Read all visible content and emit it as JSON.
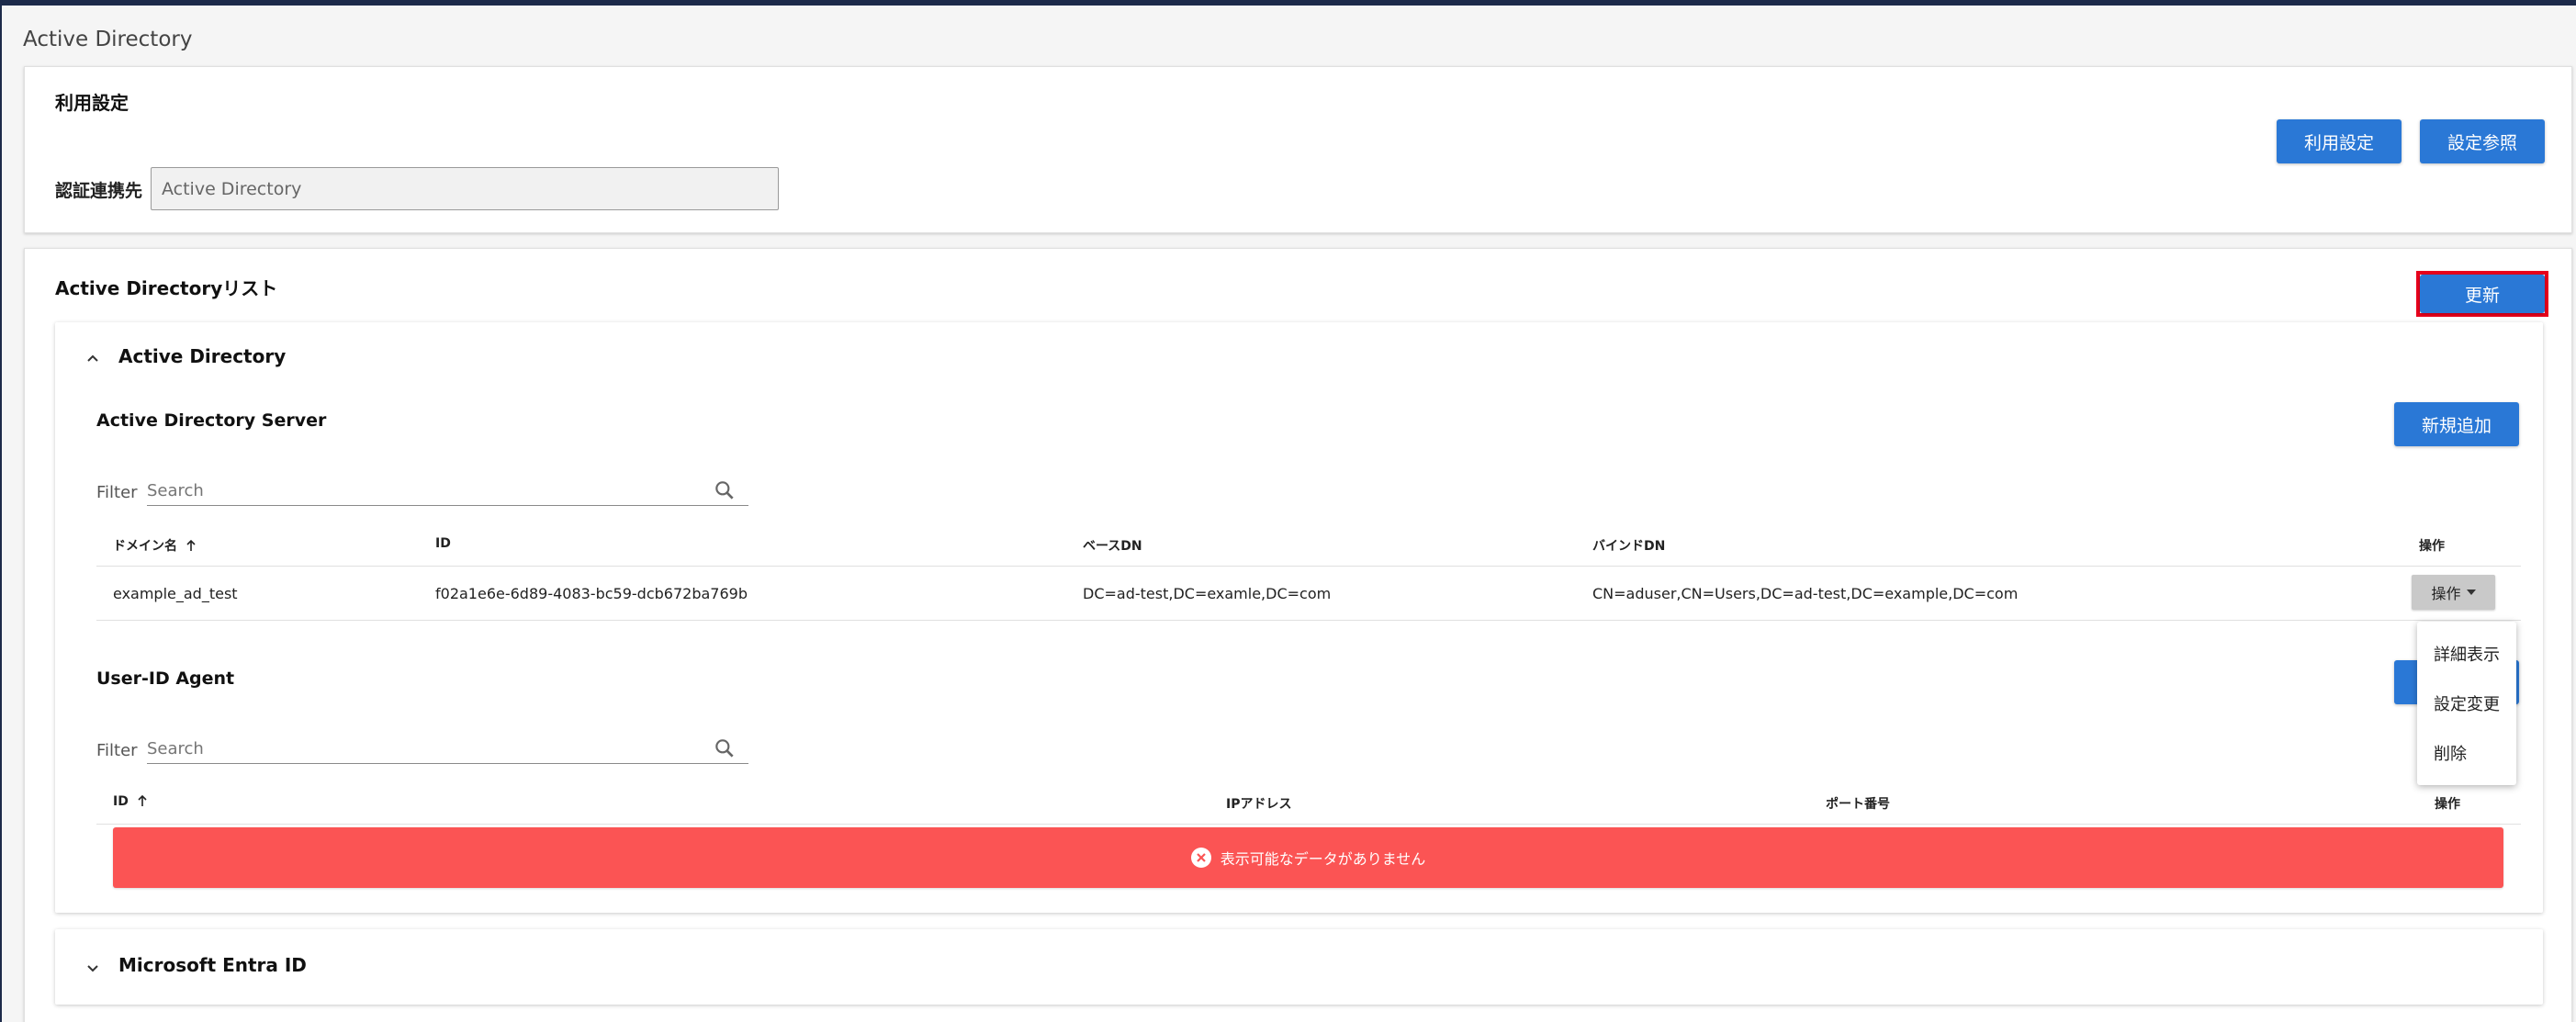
{
  "page": {
    "title": "Active Directory"
  },
  "settings": {
    "section_title": "利用設定",
    "auth_label": "認証連携先",
    "auth_value": "Active Directory",
    "buttons": {
      "use_settings": "利用設定",
      "view_settings": "設定参照"
    }
  },
  "ad_list": {
    "title": "Active Directoryリスト",
    "refresh_button": "更新",
    "accordion_title": "Active Directory",
    "server": {
      "title": "Active Directory Server",
      "add_button": "新規追加",
      "filter_label": "Filter",
      "search_placeholder": "Search",
      "columns": [
        "ドメイン名",
        "ID",
        "ベースDN",
        "バインドDN",
        "操作"
      ],
      "rows": [
        {
          "domain": "example_ad_test",
          "id": "f02a1e6e-6d89-4083-bc59-dcb672ba769b",
          "base_dn": "DC=ad-test,DC=examle,DC=com",
          "bind_dn": "CN=aduser,CN=Users,DC=ad-test,DC=example,DC=com",
          "ops_label": "操作"
        }
      ]
    },
    "ops_menu": [
      "詳細表示",
      "設定変更",
      "削除"
    ],
    "agent": {
      "title": "User-ID Agent",
      "filter_label": "Filter",
      "search_placeholder": "Search",
      "columns": [
        "ID",
        "IPアドレス",
        "ポート番号",
        "操作"
      ],
      "empty_message": "表示可能なデータがありません"
    },
    "collapsed_accordion_title": "Microsoft Entra ID"
  },
  "colors": {
    "primary": "#2a78d6",
    "error": "#fb5454",
    "highlight": "#e8001c"
  }
}
